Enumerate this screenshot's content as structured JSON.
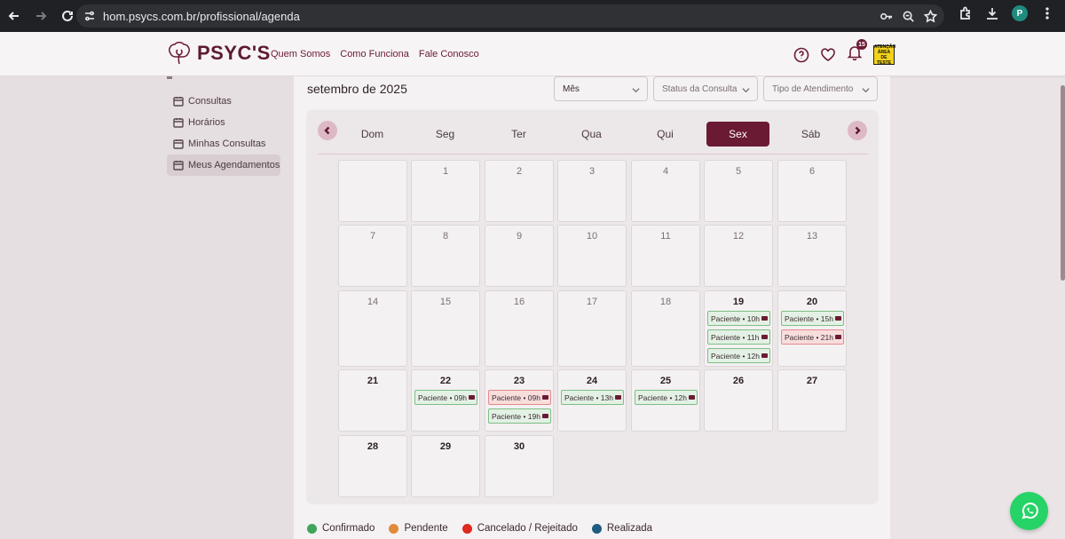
{
  "browser": {
    "url": "hom.psycs.com.br/profissional/agenda",
    "profile_initial": "P"
  },
  "header": {
    "logo_text": "PSYC'S",
    "nav": [
      "Quem Somos",
      "Como Funciona",
      "Fale Conosco"
    ],
    "notification_count": "15",
    "warning_label_1": "ATENÇÃO",
    "warning_label_2": "ÁREA DE",
    "warning_label_3": "TESTE"
  },
  "sidebar": {
    "items": [
      {
        "label": "Consultas",
        "icon": "calendar-icon"
      },
      {
        "label": "Horários",
        "icon": "calendar-icon"
      },
      {
        "label": "Minhas Consultas",
        "icon": "calendar-icon"
      },
      {
        "label": "Meus Agendamentos",
        "icon": "calendar-icon"
      }
    ],
    "active_index": 3
  },
  "calendar": {
    "month_label": "setembro de 2025",
    "view_select": "Mês",
    "status_select": "Status da Consulta",
    "type_select": "Tipo de Atendimento",
    "weekdays": [
      "Dom",
      "Seg",
      "Ter",
      "Qua",
      "Qui",
      "Sex",
      "Sáb"
    ],
    "active_weekday": "Sex",
    "days": {
      "19": [
        {
          "label": "Paciente • 10h",
          "status": "confirmado"
        },
        {
          "label": "Paciente • 11h",
          "status": "confirmado"
        },
        {
          "label": "Paciente • 12h",
          "status": "confirmado"
        }
      ],
      "20": [
        {
          "label": "Paciente • 15h",
          "status": "confirmado"
        },
        {
          "label": "Paciente • 21h",
          "status": "cancelado"
        }
      ],
      "22": [
        {
          "label": "Paciente • 09h",
          "status": "confirmado"
        }
      ],
      "23": [
        {
          "label": "Paciente • 09h",
          "status": "cancelado"
        },
        {
          "label": "Paciente • 19h",
          "status": "confirmado"
        }
      ],
      "24": [
        {
          "label": "Paciente • 13h",
          "status": "confirmado"
        }
      ],
      "25": [
        {
          "label": "Paciente • 12h",
          "status": "confirmado"
        }
      ]
    }
  },
  "legend": [
    {
      "label": "Confirmado",
      "color": "#3fa55a"
    },
    {
      "label": "Pendente",
      "color": "#e08a3a"
    },
    {
      "label": "Cancelado / Rejeitado",
      "color": "#e0281e"
    },
    {
      "label": "Realizada",
      "color": "#1f5d82"
    }
  ],
  "colors": {
    "brand": "#6b1a34",
    "accent": "#ddb9c6",
    "whatsapp": "#25d366"
  }
}
